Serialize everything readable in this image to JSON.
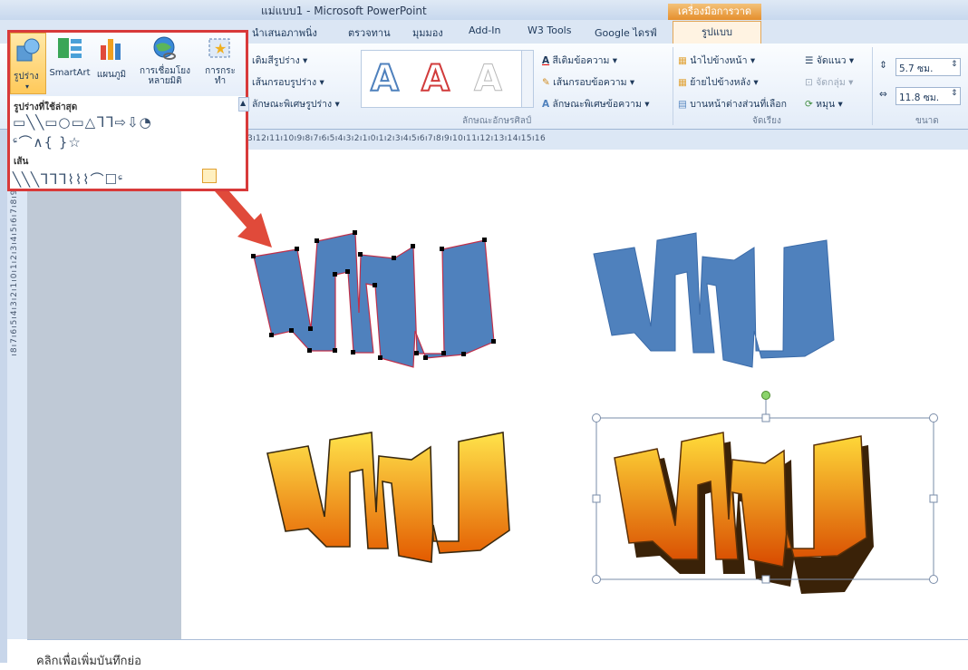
{
  "window": {
    "title": "แม่แบบ1 - Microsoft PowerPoint",
    "context_tab_group": "เครื่องมือการวาด"
  },
  "tabs": [
    {
      "label": "นำเสนอภาพนิ่ง"
    },
    {
      "label": "ตรวจทาน"
    },
    {
      "label": "มุมมอง"
    },
    {
      "label": "Add-In"
    },
    {
      "label": "W3 Tools"
    },
    {
      "label": "Google ไดรฟ์"
    },
    {
      "label": "รูปแบบ",
      "active": true
    }
  ],
  "ribbon": {
    "shape_styles": {
      "fill": "เติมสีรูปร่าง ▾",
      "outline": "เส้นกรอบรูปร่าง ▾",
      "effects": "ลักษณะพิเศษรูปร่าง ▾"
    },
    "wordart": {
      "sample_letter": "A",
      "text_fill": "สีเติมข้อความ ▾",
      "text_outline": "เส้นกรอบข้อความ ▾",
      "text_effects": "ลักษณะพิเศษข้อความ ▾",
      "group_label": "ลักษณะอักษรศิลป์"
    },
    "arrange": {
      "bring_forward": "นำไปข้างหน้า ▾",
      "send_backward": "ย้ายไปข้างหลัง ▾",
      "selection_pane": "บานหน้าต่างส่วนที่เลือก",
      "align": "จัดแนว ▾",
      "group": "จัดกลุ่ม ▾",
      "rotate": "หมุน ▾",
      "group_label": "จัดเรียง"
    },
    "size": {
      "height": "5.7 ซม.",
      "width": "11.8 ซม.",
      "group_label": "ขนาด"
    }
  },
  "shapes_panel": {
    "buttons": [
      {
        "label": "รูปร่าง",
        "icon": "shapes-icon"
      },
      {
        "label": "SmartArt",
        "icon": "smartart-icon"
      },
      {
        "label": "แผนภูมิ",
        "icon": "chart-icon"
      },
      {
        "label": "การเชื่อมโยงหลายมิติ",
        "icon": "hyperlink-globe-icon"
      },
      {
        "label": "การกระทำ",
        "icon": "action-icon"
      }
    ],
    "recent_label": "รูปร่างที่ใช้ล่าสุด",
    "recent_row1": "▭╲╲▭○▭△ᒣᒣ⇨⇩◔",
    "recent_row2": "ᶝ⌒∧{ }☆",
    "lines_label": "เส้น",
    "lines_row": "╲╲╲ᒣᒣᒣ⌇⌇⌇⌒☐ᶝ"
  },
  "ruler": {
    "horizontal": "ı13ı12ı11ı10ı9ı8ı7ı6ı5ı4ı3ı2ı1ı0ı1ı2ı3ı4ı5ı6ı7ı8ı9ı10ı11ı12ı13ı14ı15ı16",
    "vertical": "ı8ı7ı6ı5ı4ı3ı2ı1ı0ı1ı2ı3ı4ı5ı6ı7ı8ı9ı"
  },
  "slide": {
    "wordart_text": "เกม"
  },
  "notes": {
    "placeholder": "คลิกเพื่อเพิ่มบันทึกย่อ"
  },
  "colors": {
    "blue_fill": "#4f81bd",
    "orange_top": "#ffe34a",
    "orange_bottom": "#e35a00",
    "highlight_red": "#d83a3a"
  }
}
